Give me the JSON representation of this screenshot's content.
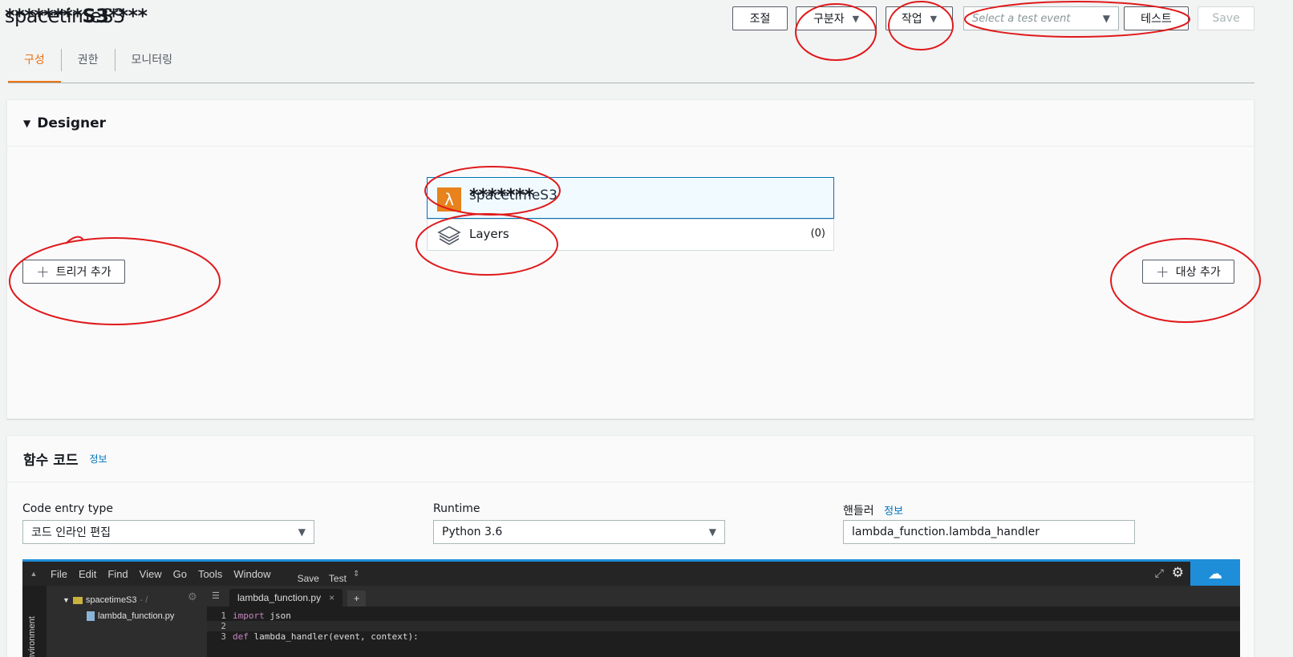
{
  "header": {
    "function_name": "spacetimeS3",
    "redaction": "********S3****"
  },
  "toolbar": {
    "throttle": "조절",
    "qualifiers": "구분자",
    "actions": "작업",
    "test_event_placeholder": "Select a test event",
    "test": "테스트",
    "save": "Save"
  },
  "tabs": [
    {
      "label": "구성",
      "active": true
    },
    {
      "label": "권한",
      "active": false
    },
    {
      "label": "모니터링",
      "active": false
    }
  ],
  "designer": {
    "title": "Designer",
    "function_name": "spacetimeS3",
    "function_redaction": "*******",
    "layers_label": "Layers",
    "layers_count": "(0)",
    "add_trigger": "트리거 추가",
    "add_destination": "대상 추가"
  },
  "function_code": {
    "title": "함수 코드",
    "info": "정보",
    "code_entry_label": "Code entry type",
    "code_entry_value": "코드 인라인 편집",
    "runtime_label": "Runtime",
    "runtime_value": "Python 3.6",
    "handler_label": "핸들러",
    "handler_info": "정보",
    "handler_value": "lambda_function.lambda_handler"
  },
  "editor": {
    "menu": [
      "File",
      "Edit",
      "Find",
      "View",
      "Go",
      "Tools",
      "Window"
    ],
    "save": "Save",
    "test": "Test",
    "environment_label": "Environment",
    "folder": "spacetimeS3",
    "folder_suffix": "- /",
    "file": "lambda_function.py",
    "tab_file": "lambda_function.py",
    "lines": [
      {
        "n": "1",
        "kw": "import",
        "rest": " json"
      },
      {
        "n": "2",
        "kw": "",
        "rest": ""
      },
      {
        "n": "3",
        "kw": "def",
        "rest": " lambda_handler(event, context):"
      }
    ]
  },
  "colors": {
    "accent_orange": "#ec7211",
    "link_blue": "#0073bb",
    "annotation_red": "#e0191b"
  }
}
